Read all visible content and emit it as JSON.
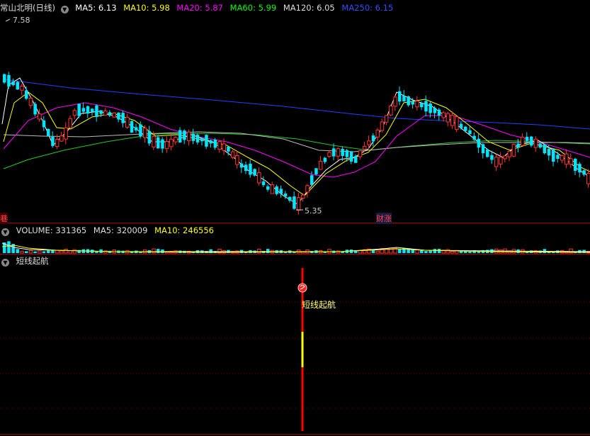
{
  "main": {
    "title": "常山北明(日线)",
    "ma": [
      {
        "label": "MA5: 6.13",
        "color": "#ffffff"
      },
      {
        "label": "MA10: 5.98",
        "color": "#ffff00"
      },
      {
        "label": "MA20: 5.87",
        "color": "#ff00ff"
      },
      {
        "label": "MA60: 5.99",
        "color": "#00ff00"
      },
      {
        "label": "MA120: 6.05",
        "color": "#dddddd"
      },
      {
        "label": "MA250: 6.15",
        "color": "#3050ff"
      }
    ],
    "high_label": "7.58",
    "low_label": "5.35",
    "tag_left": "巷",
    "tag_mid": "财涨"
  },
  "volume": {
    "label": "VOLUME: 331365",
    "ma5": "MA5: 320009",
    "ma10": "MA10: 246556"
  },
  "indicator": {
    "title": "短线起航",
    "signal_label": "短线起航"
  },
  "colors": {
    "up": "#ff3333",
    "down": "#00e5ff",
    "bg": "#000000",
    "grid": "#8a0000"
  }
}
